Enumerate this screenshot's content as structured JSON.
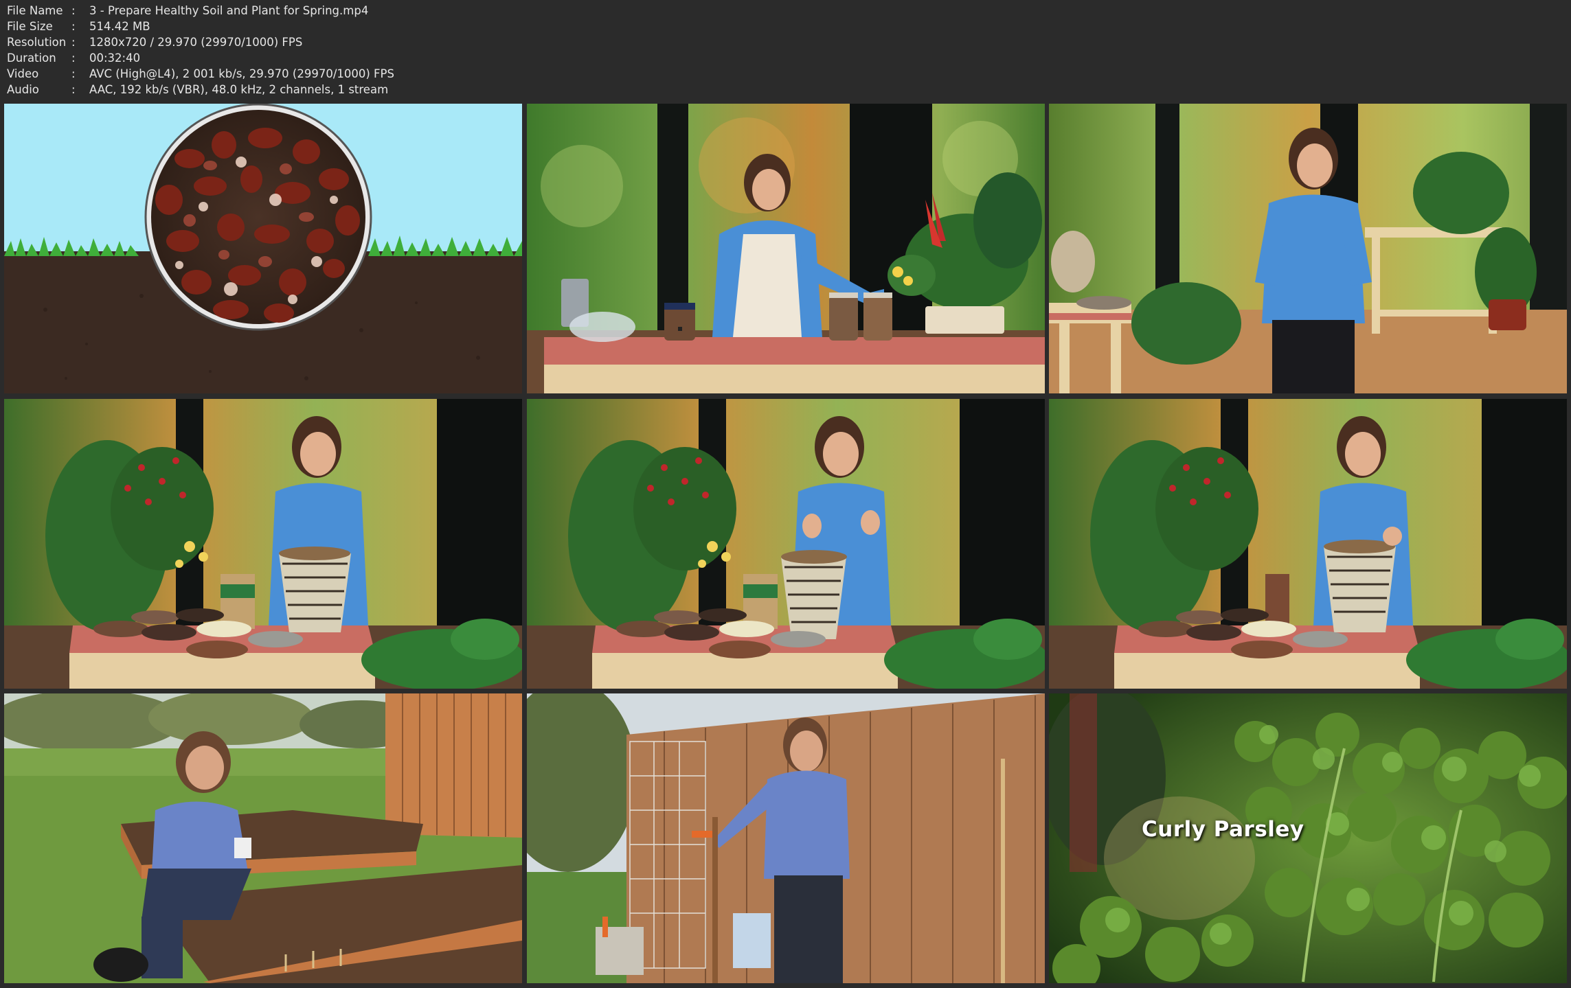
{
  "info": [
    {
      "label": "File Name",
      "value": "3 - Prepare Healthy Soil and Plant for Spring.mp4"
    },
    {
      "label": "File Size",
      "value": "514.42 MB"
    },
    {
      "label": "Resolution",
      "value": "1280x720 / 29.970 (29970/1000) FPS"
    },
    {
      "label": "Duration",
      "value": "00:32:40"
    },
    {
      "label": "Video",
      "value": "AVC (High@L4), 2 001 kb/s, 29.970 (29970/1000) FPS"
    },
    {
      "label": "Audio",
      "value": "AAC, 192 kb/s (VBR), 48.0 kHz, 2 channels, 1 stream"
    }
  ],
  "separator": ":",
  "frames": {
    "f9": {
      "caption": "Curly Parsley"
    }
  },
  "colors": {
    "background": "#2b2b2b",
    "text": "#e6e6e6"
  }
}
